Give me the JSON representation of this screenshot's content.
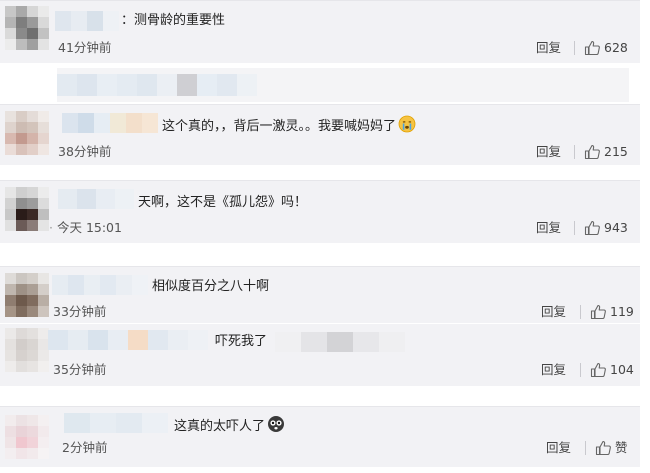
{
  "comments": [
    {
      "text": "：测骨龄的重要性",
      "time": "41分钟前",
      "reply": "回复",
      "likes": "628"
    },
    {
      "text": "这个真的，，背后一激灵。。我要喊妈妈了",
      "emoji": "crying-face-icon",
      "time": "38分钟前",
      "reply": "回复",
      "likes": "215"
    },
    {
      "text": "天啊，这不是《孤儿怨》吗！",
      "time": "今天 15:01",
      "reply": "回复",
      "likes": "943"
    },
    {
      "text": "相似度百分之八十啊",
      "time": "33分钟前",
      "reply": "回复",
      "likes": "119"
    },
    {
      "text": "吓死我了",
      "time": "35分钟前",
      "reply": "回复",
      "likes": "104"
    },
    {
      "text": "这真的太吓人了",
      "emoji": "shocked-face-icon",
      "time": "2分钟前",
      "reply": "回复",
      "likes": "赞"
    }
  ],
  "colors": {
    "background": "#f2f2f5",
    "border": "#e6e6ea",
    "text": "#222222",
    "meta": "#555555"
  }
}
